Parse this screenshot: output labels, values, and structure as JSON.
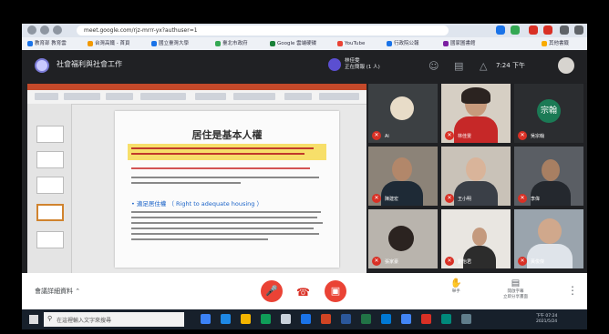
{
  "browser": {
    "url": "meet.google.com/rjz-mrrr-yx?authuser=1",
    "bookmarks": [
      "教育部 教育雲",
      "台灣高鐵 - 首頁",
      "國立臺灣大學",
      "臺北市政府",
      "Google 雲端硬碟",
      "YouTube",
      "行政院公報",
      "國家圖書館",
      "其他書籤"
    ]
  },
  "meet": {
    "title": "社會福利與社會工作",
    "presenter_name": "林佳雯",
    "presenter_sub": "正在簡報 (1 人)",
    "clock": "7:24 下午",
    "meeting_details_label": "會議詳細資料"
  },
  "slide": {
    "title": "居住是基本人權",
    "link_text": "• 適足居住權 （ Right to adequate housing ）",
    "yellow_color": "#f7df6a",
    "title_color": "#333333"
  },
  "tiles": [
    {
      "name": "Ai"
    },
    {
      "name": "林佳雯"
    },
    {
      "name": "吳宗翰",
      "initial": "宗翰"
    },
    {
      "name": "陳建宏"
    },
    {
      "name": "王小明"
    },
    {
      "name": "李偉"
    },
    {
      "name": "張家豪"
    },
    {
      "name": "劉怡君"
    },
    {
      "name": "黃俊傑"
    }
  ],
  "bottom": {
    "present_label": "舉手",
    "captions_label": "開啟字幕",
    "present_now_label": "立即分享畫面"
  },
  "taskbar": {
    "search_placeholder": "在這裡輸入文字來搜尋",
    "tray_time": "下午 07:24",
    "tray_date": "2021/5/24"
  },
  "colors": {
    "accent_red": "#ea4335",
    "meet_dark": "#202124",
    "ppt_orange": "#c4492a"
  }
}
